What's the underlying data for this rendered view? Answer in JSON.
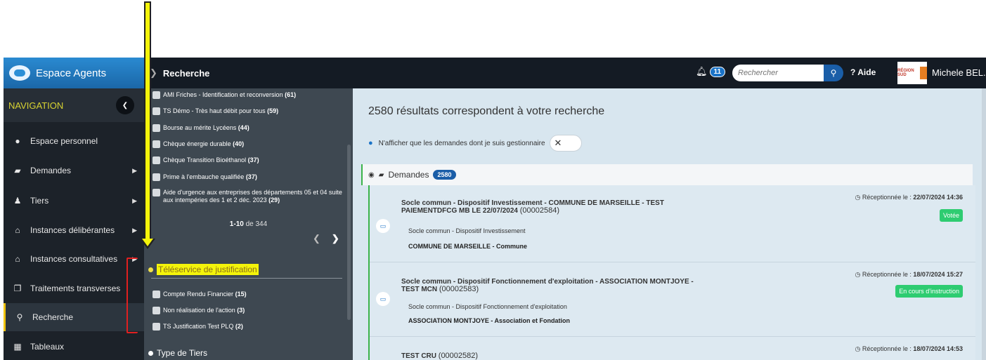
{
  "header": {
    "brand": "Espace Agents",
    "breadcrumb": "Recherche",
    "notifications_count": "11",
    "search_placeholder": "Rechercher",
    "help_label": "Aide",
    "region_logo_text": "RÉGION SUD",
    "user_name": "Michele BEL..."
  },
  "sidebar": {
    "title": "NAVIGATION",
    "items": [
      {
        "label": "Espace personnel",
        "icon": "info-circle-icon",
        "has_submenu": false
      },
      {
        "label": "Demandes",
        "icon": "folder-open-icon",
        "has_submenu": true
      },
      {
        "label": "Tiers",
        "icon": "users-icon",
        "has_submenu": true
      },
      {
        "label": "Instances délibérantes",
        "icon": "institution-icon",
        "has_submenu": true
      },
      {
        "label": "Instances consultatives",
        "icon": "institution-icon",
        "has_submenu": true
      },
      {
        "label": "Traitements transverses",
        "icon": "copy-icon",
        "has_submenu": false
      },
      {
        "label": "Recherche",
        "icon": "search-icon",
        "has_submenu": false,
        "active": true
      },
      {
        "label": "Tableaux",
        "icon": "table-icon",
        "has_submenu": false
      }
    ]
  },
  "facets": {
    "dispositifs": [
      {
        "label": "AMI Friches - Identification et reconversion",
        "count": "(61)"
      },
      {
        "label": "TS Démo - Très haut débit pour tous",
        "count": "(59)"
      },
      {
        "label": "Bourse au mérite Lycéens",
        "count": "(44)"
      },
      {
        "label": "Chèque énergie durable",
        "count": "(40)"
      },
      {
        "label": "Chèque Transition Bioéthanol",
        "count": "(37)"
      },
      {
        "label": "Prime à l'embauche qualifiée",
        "count": "(37)"
      },
      {
        "label": "Aide d'urgence aux entreprises des départements 05 et 04 suite aux intempéries des 1 et 2 déc. 2023",
        "count": "(29)"
      }
    ],
    "pager_range": "1-10",
    "pager_of": "de 344",
    "justification_group": "Téléservice de justification",
    "justification_items": [
      {
        "label": "Compte Rendu Financier",
        "count": "(15)"
      },
      {
        "label": "Non réalisation de l'action",
        "count": "(3)"
      },
      {
        "label": "TS Justification Test PLQ",
        "count": "(2)"
      }
    ],
    "tiers_group": "Type de Tiers"
  },
  "main": {
    "results_text": "2580 résultats correspondent à votre recherche",
    "filter_label": "N'afficher que les demandes dont je suis gestionnaire",
    "demandes_label": "Demandes",
    "demandes_count": "2580",
    "received_prefix": "Réceptionnée le :",
    "results": [
      {
        "title": "Socle commun - Dispositif Investissement - COMMUNE DE MARSEILLE - TEST PAIEMENTDFCG MB LE 22/07/2024",
        "number": "(00002584)",
        "received": "22/07/2024 14:36",
        "subtitle": "Socle commun - Dispositif Investissement",
        "tiers": "COMMUNE DE MARSEILLE - Commune",
        "status": "Votée",
        "status_color": "#2ecc71"
      },
      {
        "title": "Socle commun - Dispositif Fonctionnement d'exploitation - ASSOCIATION MONTJOYE - TEST MCN",
        "number": "(00002583)",
        "received": "18/07/2024 15:27",
        "subtitle": "Socle commun - Dispositif Fonctionnement d'exploitation",
        "tiers": "ASSOCIATION MONTJOYE - Association et Fondation",
        "status": "En cours d'instruction",
        "status_color": "#2ecc71"
      },
      {
        "title": "TEST CRU",
        "number": "(00002582)",
        "received": "18/07/2024 14:53",
        "subtitle": "",
        "tiers": "",
        "status": "",
        "status_color": "#2ecc71"
      }
    ]
  },
  "annotations": {
    "arrow_color": "#f4f40a",
    "bracket_color": "#e02020"
  }
}
